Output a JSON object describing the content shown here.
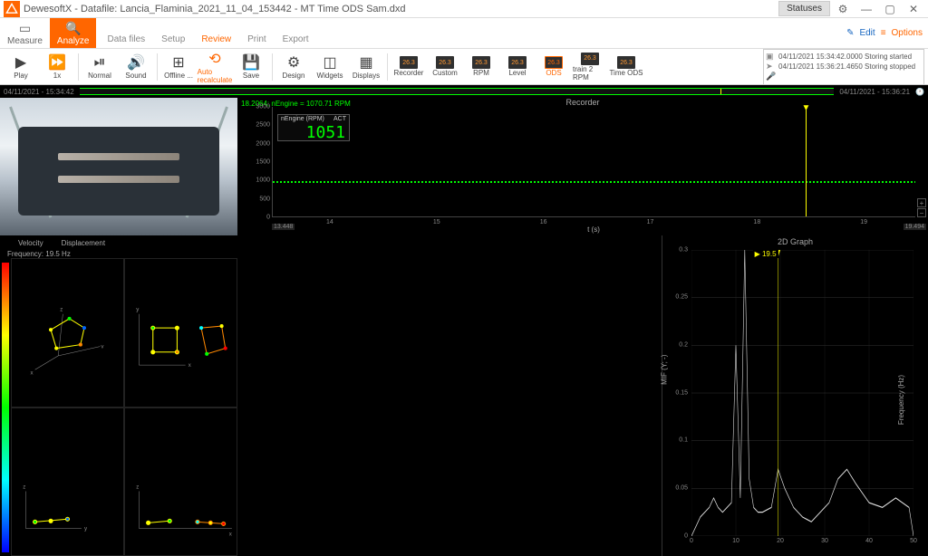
{
  "app": {
    "title": "DewesoftX - Datafile: Lancia_Flaminia_2021_11_04_153442 - MT Time ODS Sam.dxd",
    "statuses_btn": "Statuses",
    "edit": "Edit",
    "options": "Options"
  },
  "main_tabs": [
    {
      "label": "Measure",
      "icon": "camera"
    },
    {
      "label": "Analyze",
      "icon": "search",
      "active": true
    }
  ],
  "sub_tabs": [
    "Data files",
    "Setup",
    "Review",
    "Print",
    "Export"
  ],
  "sub_tab_active": 2,
  "toolbar": [
    {
      "label": "Play",
      "icon": "▶",
      "name": "play-button"
    },
    {
      "label": "1x",
      "icon": "▶▶",
      "name": "speed-button"
    },
    {
      "label": "Normal",
      "icon": "▶|",
      "name": "normal-button"
    },
    {
      "label": "Sound",
      "icon": "🔊",
      "name": "sound-button"
    },
    {
      "label": "Offline ...",
      "icon": "⊞",
      "name": "offline-button"
    },
    {
      "label": "Auto recalculate",
      "icon": "⟳",
      "name": "auto-recalc-button",
      "orange": true
    },
    {
      "label": "Save",
      "icon": "💾",
      "name": "save-button"
    },
    {
      "label": "Design",
      "icon": "⚙",
      "name": "design-button"
    },
    {
      "label": "Widgets",
      "icon": "⊡",
      "name": "widgets-button"
    },
    {
      "label": "Displays",
      "icon": "▦",
      "name": "displays-button"
    }
  ],
  "display_tabs": [
    {
      "label": "Recorder",
      "val": "26.3"
    },
    {
      "label": "Custom",
      "val": "26.3"
    },
    {
      "label": "RPM",
      "val": "26.3"
    },
    {
      "label": "Level",
      "val": "26.3"
    },
    {
      "label": "ODS",
      "val": "26.3",
      "active": true
    },
    {
      "label": "train 2 RPM",
      "val": "26.3"
    },
    {
      "label": "Time ODS",
      "val": "26.3"
    }
  ],
  "status_log": [
    {
      "icon": "▣",
      "text": "04/11/2021 15:34:42.0000 Storing started"
    },
    {
      "icon": "▶",
      "text": "04/11/2021 15:36:21.4650 Storing stopped"
    },
    {
      "icon": "🎤",
      "text": ""
    }
  ],
  "timebar": {
    "start": "04/11/2021 - 15:34:42",
    "end": "04/11/2021 - 15:36:21"
  },
  "recorder": {
    "title": "Recorder",
    "info": "18.2064; nEngine = 1070.71 RPM",
    "box_label": "nEngine (RPM)",
    "box_tag": "ACT",
    "box_value": "1051",
    "y_ticks": [
      "3000",
      "2500",
      "2000",
      "1500",
      "1000",
      "500",
      "0"
    ],
    "x_ticks": [
      "14",
      "15",
      "16",
      "17",
      "18",
      "19"
    ],
    "x_start": "13.448",
    "x_end": "19.494",
    "x_unit": "t (s)"
  },
  "modes": {
    "tabs": [
      "Velocity",
      "Displacement"
    ],
    "freq": "Frequency: 19.5 Hz"
  },
  "graph2d": {
    "title": "2D Graph",
    "ylabel": "MIF (Y; -)",
    "xlabel": "Frequency (Hz)",
    "cursor": "19.5",
    "y_ticks": [
      "0.3",
      "0.25",
      "0.2",
      "0.15",
      "0.1",
      "0.05",
      "0"
    ],
    "x_ticks": [
      "0",
      "10",
      "20",
      "30",
      "40",
      "50"
    ]
  },
  "chart_data": [
    {
      "type": "line",
      "title": "Recorder",
      "xlabel": "t (s)",
      "ylabel": "nEngine (RPM)",
      "xlim": [
        13.448,
        19.494
      ],
      "ylim": [
        0,
        3000
      ],
      "x": [
        13.5,
        14,
        14.5,
        15,
        15.5,
        16,
        16.5,
        17,
        17.5,
        18,
        18.2,
        18.5,
        19,
        19.49
      ],
      "values": [
        1048,
        1050,
        1049,
        1051,
        1052,
        1055,
        1058,
        1060,
        1062,
        1065,
        1070,
        1072,
        1075,
        1078
      ],
      "cursor_x": 18.2
    },
    {
      "type": "line",
      "title": "2D Graph",
      "xlabel": "Frequency (Hz)",
      "ylabel": "MIF (Y; -)",
      "xlim": [
        0,
        50
      ],
      "ylim": [
        0,
        0.3
      ],
      "x": [
        0,
        2,
        4,
        5,
        6,
        7,
        8,
        9,
        10,
        11,
        12,
        13,
        14,
        15,
        16,
        18,
        19.5,
        21,
        23,
        25,
        27,
        29,
        31,
        33,
        35,
        37,
        40,
        43,
        46,
        49,
        50
      ],
      "values": [
        0.0,
        0.02,
        0.03,
        0.04,
        0.03,
        0.025,
        0.03,
        0.035,
        0.2,
        0.04,
        0.3,
        0.06,
        0.03,
        0.025,
        0.025,
        0.03,
        0.07,
        0.05,
        0.03,
        0.02,
        0.015,
        0.025,
        0.035,
        0.06,
        0.07,
        0.055,
        0.035,
        0.03,
        0.04,
        0.03,
        0.0
      ],
      "cursor_x": 19.5
    }
  ]
}
